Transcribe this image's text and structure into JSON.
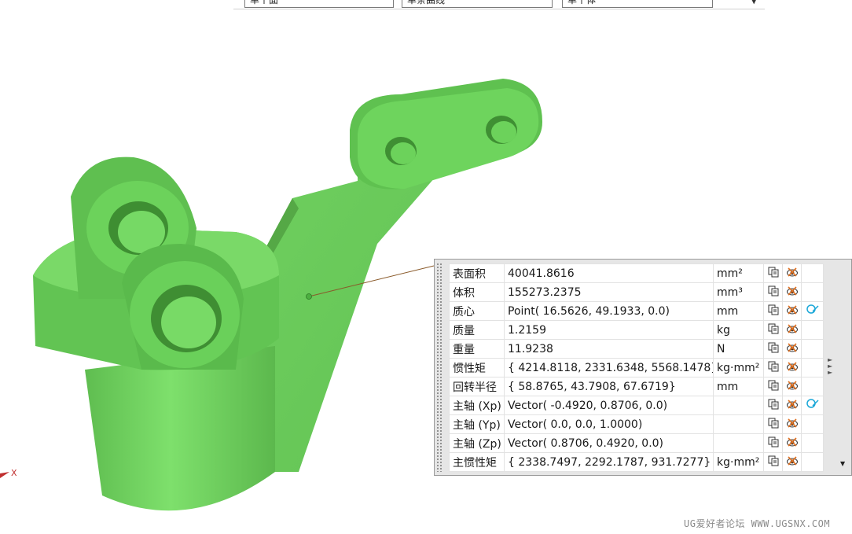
{
  "toolbar": {
    "fields": [
      "单个面",
      "单条曲线",
      "单个体"
    ]
  },
  "viewport": {
    "body_color": "#6fcf5f",
    "axis_label": "X"
  },
  "measure_panel": {
    "rows": [
      {
        "name": "表面积",
        "value": "40041.8616",
        "unit": "mm²",
        "has_vector": false
      },
      {
        "name": "体积",
        "value": "155273.2375",
        "unit": "mm³",
        "has_vector": false
      },
      {
        "name": "质心",
        "value": "Point( 16.5626, 49.1933, 0.0)",
        "unit": "mm",
        "has_vector": true
      },
      {
        "name": "质量",
        "value": "1.2159",
        "unit": "kg",
        "has_vector": false
      },
      {
        "name": "重量",
        "value": "11.9238",
        "unit": "N",
        "has_vector": false
      },
      {
        "name": "惯性矩",
        "value": "{ 4214.8118, 2331.6348, 5568.1478}",
        "unit": "kg·mm²",
        "has_vector": false
      },
      {
        "name": "回转半径",
        "value": "{ 58.8765, 43.7908, 67.6719}",
        "unit": "mm",
        "has_vector": false
      },
      {
        "name": "主轴 (Xp)",
        "value": "Vector( -0.4920, 0.8706, 0.0)",
        "unit": "",
        "has_vector": true
      },
      {
        "name": "主轴 (Yp)",
        "value": "Vector( 0.0, 0.0, 1.0000)",
        "unit": "",
        "has_vector": false
      },
      {
        "name": "主轴 (Zp)",
        "value": "Vector( 0.8706, 0.4920, 0.0)",
        "unit": "",
        "has_vector": false
      },
      {
        "name": "主惯性矩",
        "value": "{ 2338.7497, 2292.1787, 931.7277}",
        "unit": "kg·mm²",
        "has_vector": false
      }
    ],
    "icons": {
      "copy": "copy-to-clipboard-icon",
      "show": "show-result-icon",
      "vector": "vector-display-icon"
    }
  },
  "watermark": "UG爱好者论坛 WWW.UGSNX.COM"
}
